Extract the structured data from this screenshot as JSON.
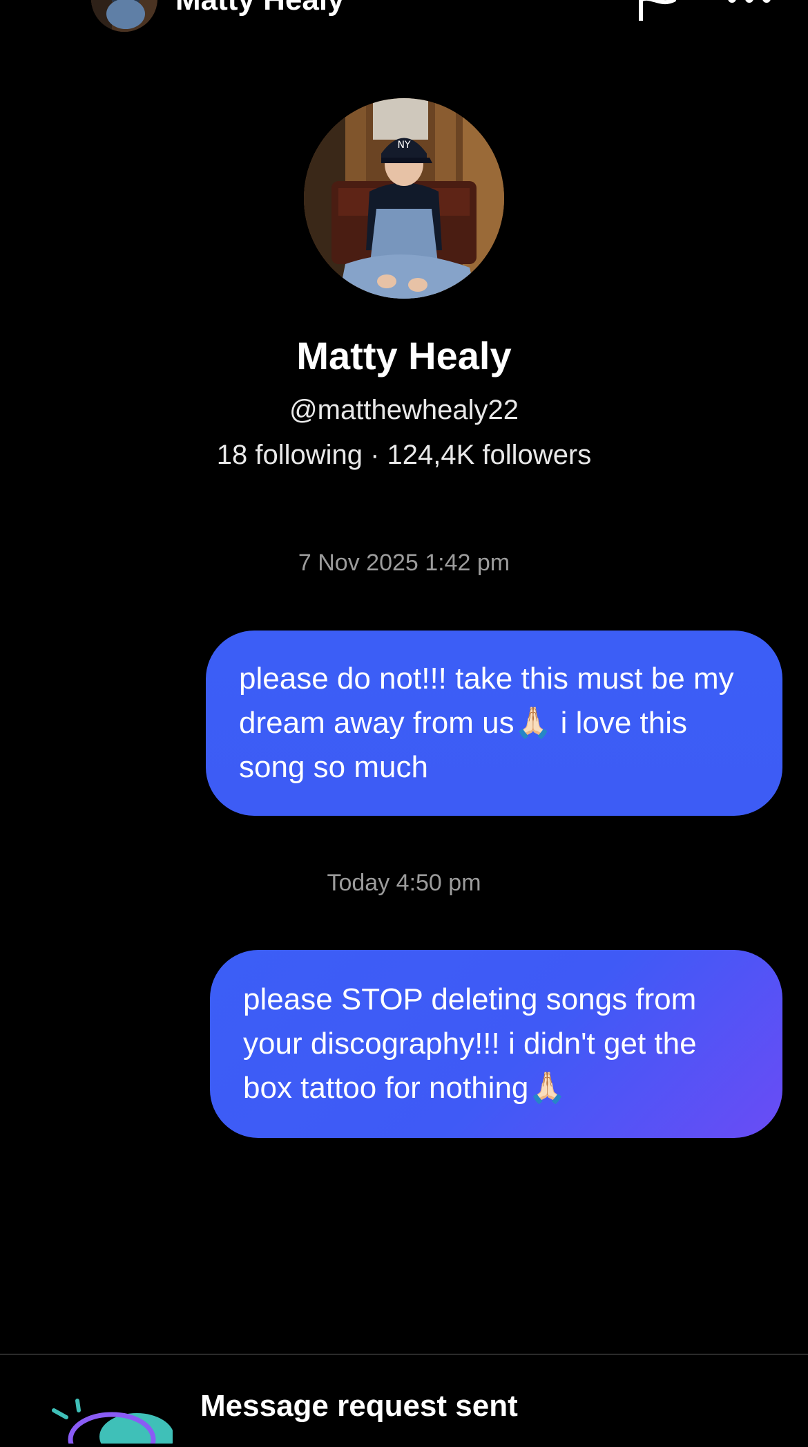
{
  "header": {
    "name": "Matty Healy",
    "back_icon": "chevron-left-icon",
    "report_icon": "flag-icon",
    "more_icon": "more-horizontal-icon"
  },
  "profile": {
    "name": "Matty Healy",
    "handle": "@matthewhealy22",
    "stats": "18 following · 124,4K followers"
  },
  "messages": [
    {
      "timestamp": "7 Nov 2025 1:42 pm",
      "text": "please do not!!! take this must be my dream away from us🙏🏻 i love this song so much"
    },
    {
      "timestamp": "Today 4:50 pm",
      "text": "please STOP deleting songs from your discography!!! i didn't get the box tattoo for nothing🙏🏻"
    }
  ],
  "request_panel": {
    "title": "Message request sent",
    "icon": "message-request-illustration-icon"
  },
  "colors": {
    "background": "#000000",
    "bubble": "#3d5cf5",
    "bubble_gradient_end": "#6a4cf5",
    "timestamp": "#9c9c9c",
    "accent_teal": "#3fc0b8",
    "accent_purple": "#8a5cf5"
  }
}
